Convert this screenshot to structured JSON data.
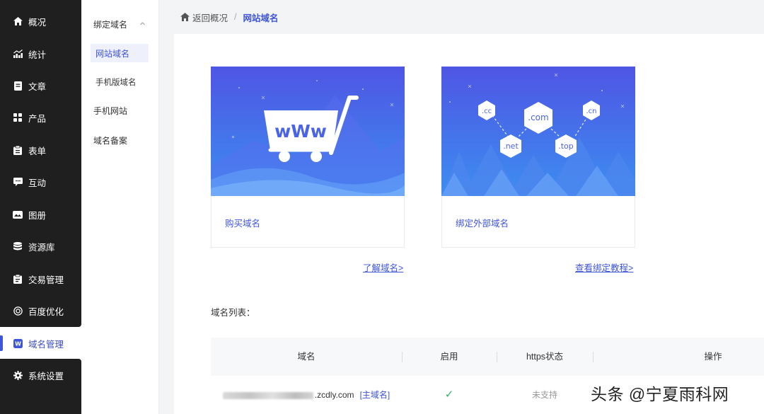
{
  "sidebar": {
    "items": [
      {
        "label": "概况",
        "icon": "home-icon"
      },
      {
        "label": "统计",
        "icon": "chart-icon"
      },
      {
        "label": "文章",
        "icon": "article-icon"
      },
      {
        "label": "产品",
        "icon": "product-icon"
      },
      {
        "label": "表单",
        "icon": "form-icon"
      },
      {
        "label": "互动",
        "icon": "chat-icon"
      },
      {
        "label": "图册",
        "icon": "album-icon"
      },
      {
        "label": "资源库",
        "icon": "database-icon"
      },
      {
        "label": "交易管理",
        "icon": "trade-icon"
      },
      {
        "label": "百度优化",
        "icon": "seo-icon"
      },
      {
        "label": "域名管理",
        "icon": "domain-icon",
        "active": true
      },
      {
        "label": "系统设置",
        "icon": "gear-icon"
      }
    ]
  },
  "submenu": {
    "group": "绑定域名",
    "children": [
      "网站域名",
      "手机版域名"
    ],
    "items": [
      "手机网站",
      "域名备案"
    ]
  },
  "breadcrumb": {
    "back": "返回概况",
    "separator": "/",
    "current": "网站域名"
  },
  "cards": [
    {
      "label": "购买域名",
      "link": "了解域名>"
    },
    {
      "label": "绑定外部域名",
      "link": "查看绑定教程>"
    }
  ],
  "illustration": {
    "cart_text": "wWw",
    "tlds": [
      ".cc",
      ".com",
      ".cn",
      ".net",
      ".top"
    ]
  },
  "list": {
    "title": "域名列表：",
    "columns": [
      "域名",
      "启用",
      "https状态",
      "操作"
    ],
    "rows": [
      {
        "domain_suffix": ".zcdly.com",
        "tag": "[主域名]",
        "enabled": "✓",
        "https": "未支持"
      }
    ]
  },
  "watermark": "头条 @宁夏雨科网",
  "colors": {
    "accent": "#3d55d6",
    "sidebar_bg": "#1f1f1f",
    "card_gradient_top": "#4f55e4",
    "card_gradient_bottom": "#3c8ef0",
    "check": "#2fb36a"
  }
}
